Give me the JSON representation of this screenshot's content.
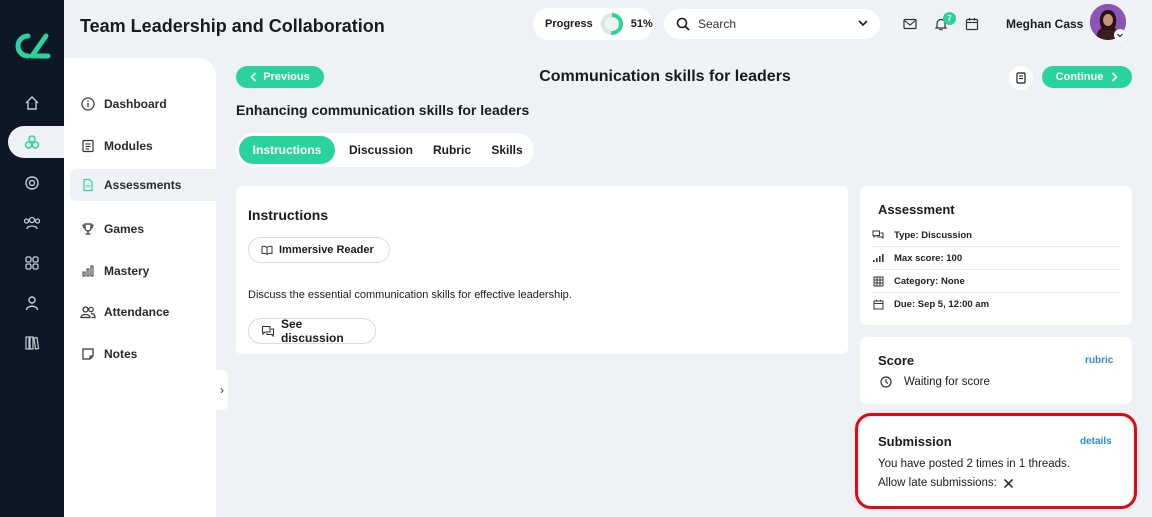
{
  "header": {
    "title": "Team Leadership and Collaboration",
    "progress_label": "Progress",
    "progress_value": "51%",
    "progress_fraction": 0.51,
    "search_placeholder": "Search",
    "notification_count": "7",
    "user_name": "Meghan Cass"
  },
  "sidebar": {
    "items": [
      {
        "label": "Dashboard",
        "icon": "info-circle-icon"
      },
      {
        "label": "Modules",
        "icon": "document-icon"
      },
      {
        "label": "Assessments",
        "icon": "file-icon",
        "active": true
      },
      {
        "label": "Games",
        "icon": "trophy-icon"
      },
      {
        "label": "Mastery",
        "icon": "bars-icon"
      },
      {
        "label": "Attendance",
        "icon": "people-icon"
      },
      {
        "label": "Notes",
        "icon": "note-icon"
      }
    ]
  },
  "toolbar": {
    "previous_label": "Previous",
    "continue_label": "Continue",
    "page_title": "Communication skills for leaders"
  },
  "content": {
    "subtitle": "Enhancing communication skills for leaders",
    "tabs": [
      "Instructions",
      "Discussion",
      "Rubric",
      "Skills"
    ],
    "instructions": {
      "heading": "Instructions",
      "immersive_reader": "Immersive Reader",
      "body": "Discuss the essential communication skills for effective leadership.",
      "see_discussion": "See discussion"
    }
  },
  "assessment": {
    "heading": "Assessment",
    "type": "Type: Discussion",
    "max_score": "Max score: 100",
    "category": "Category: None",
    "due": "Due: Sep 5, 12:00 am"
  },
  "score": {
    "heading": "Score",
    "link": "rubric",
    "status": "Waiting for score"
  },
  "submission": {
    "heading": "Submission",
    "link": "details",
    "posts": "You have posted 2 times in 1 threads.",
    "late_label": "Allow late submissions:"
  },
  "colors": {
    "accent": "#2ad39b",
    "rail": "#0e1726",
    "link": "#2b8cd6",
    "highlight": "#e30613"
  }
}
